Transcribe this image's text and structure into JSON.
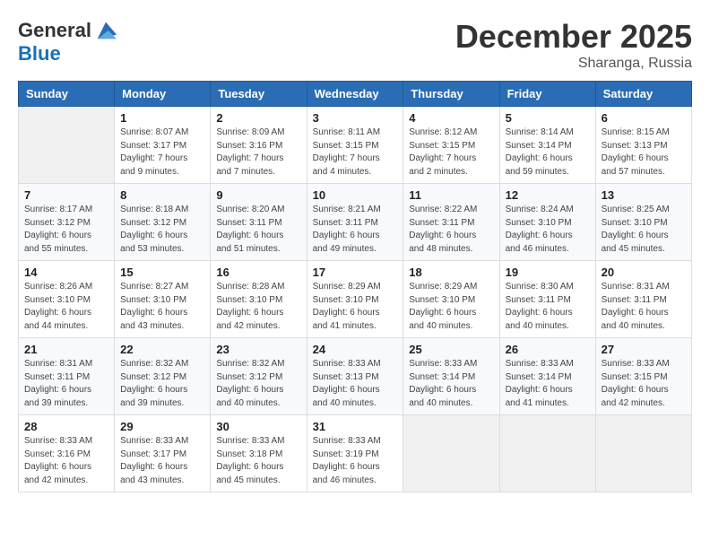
{
  "logo": {
    "line1": "General",
    "line2": "Blue"
  },
  "header": {
    "month": "December 2025",
    "location": "Sharanga, Russia"
  },
  "weekdays": [
    "Sunday",
    "Monday",
    "Tuesday",
    "Wednesday",
    "Thursday",
    "Friday",
    "Saturday"
  ],
  "weeks": [
    [
      {
        "day": "",
        "info": ""
      },
      {
        "day": "1",
        "info": "Sunrise: 8:07 AM\nSunset: 3:17 PM\nDaylight: 7 hours\nand 9 minutes."
      },
      {
        "day": "2",
        "info": "Sunrise: 8:09 AM\nSunset: 3:16 PM\nDaylight: 7 hours\nand 7 minutes."
      },
      {
        "day": "3",
        "info": "Sunrise: 8:11 AM\nSunset: 3:15 PM\nDaylight: 7 hours\nand 4 minutes."
      },
      {
        "day": "4",
        "info": "Sunrise: 8:12 AM\nSunset: 3:15 PM\nDaylight: 7 hours\nand 2 minutes."
      },
      {
        "day": "5",
        "info": "Sunrise: 8:14 AM\nSunset: 3:14 PM\nDaylight: 6 hours\nand 59 minutes."
      },
      {
        "day": "6",
        "info": "Sunrise: 8:15 AM\nSunset: 3:13 PM\nDaylight: 6 hours\nand 57 minutes."
      }
    ],
    [
      {
        "day": "7",
        "info": "Sunrise: 8:17 AM\nSunset: 3:12 PM\nDaylight: 6 hours\nand 55 minutes."
      },
      {
        "day": "8",
        "info": "Sunrise: 8:18 AM\nSunset: 3:12 PM\nDaylight: 6 hours\nand 53 minutes."
      },
      {
        "day": "9",
        "info": "Sunrise: 8:20 AM\nSunset: 3:11 PM\nDaylight: 6 hours\nand 51 minutes."
      },
      {
        "day": "10",
        "info": "Sunrise: 8:21 AM\nSunset: 3:11 PM\nDaylight: 6 hours\nand 49 minutes."
      },
      {
        "day": "11",
        "info": "Sunrise: 8:22 AM\nSunset: 3:11 PM\nDaylight: 6 hours\nand 48 minutes."
      },
      {
        "day": "12",
        "info": "Sunrise: 8:24 AM\nSunset: 3:10 PM\nDaylight: 6 hours\nand 46 minutes."
      },
      {
        "day": "13",
        "info": "Sunrise: 8:25 AM\nSunset: 3:10 PM\nDaylight: 6 hours\nand 45 minutes."
      }
    ],
    [
      {
        "day": "14",
        "info": "Sunrise: 8:26 AM\nSunset: 3:10 PM\nDaylight: 6 hours\nand 44 minutes."
      },
      {
        "day": "15",
        "info": "Sunrise: 8:27 AM\nSunset: 3:10 PM\nDaylight: 6 hours\nand 43 minutes."
      },
      {
        "day": "16",
        "info": "Sunrise: 8:28 AM\nSunset: 3:10 PM\nDaylight: 6 hours\nand 42 minutes."
      },
      {
        "day": "17",
        "info": "Sunrise: 8:29 AM\nSunset: 3:10 PM\nDaylight: 6 hours\nand 41 minutes."
      },
      {
        "day": "18",
        "info": "Sunrise: 8:29 AM\nSunset: 3:10 PM\nDaylight: 6 hours\nand 40 minutes."
      },
      {
        "day": "19",
        "info": "Sunrise: 8:30 AM\nSunset: 3:11 PM\nDaylight: 6 hours\nand 40 minutes."
      },
      {
        "day": "20",
        "info": "Sunrise: 8:31 AM\nSunset: 3:11 PM\nDaylight: 6 hours\nand 40 minutes."
      }
    ],
    [
      {
        "day": "21",
        "info": "Sunrise: 8:31 AM\nSunset: 3:11 PM\nDaylight: 6 hours\nand 39 minutes."
      },
      {
        "day": "22",
        "info": "Sunrise: 8:32 AM\nSunset: 3:12 PM\nDaylight: 6 hours\nand 39 minutes."
      },
      {
        "day": "23",
        "info": "Sunrise: 8:32 AM\nSunset: 3:12 PM\nDaylight: 6 hours\nand 40 minutes."
      },
      {
        "day": "24",
        "info": "Sunrise: 8:33 AM\nSunset: 3:13 PM\nDaylight: 6 hours\nand 40 minutes."
      },
      {
        "day": "25",
        "info": "Sunrise: 8:33 AM\nSunset: 3:14 PM\nDaylight: 6 hours\nand 40 minutes."
      },
      {
        "day": "26",
        "info": "Sunrise: 8:33 AM\nSunset: 3:14 PM\nDaylight: 6 hours\nand 41 minutes."
      },
      {
        "day": "27",
        "info": "Sunrise: 8:33 AM\nSunset: 3:15 PM\nDaylight: 6 hours\nand 42 minutes."
      }
    ],
    [
      {
        "day": "28",
        "info": "Sunrise: 8:33 AM\nSunset: 3:16 PM\nDaylight: 6 hours\nand 42 minutes."
      },
      {
        "day": "29",
        "info": "Sunrise: 8:33 AM\nSunset: 3:17 PM\nDaylight: 6 hours\nand 43 minutes."
      },
      {
        "day": "30",
        "info": "Sunrise: 8:33 AM\nSunset: 3:18 PM\nDaylight: 6 hours\nand 45 minutes."
      },
      {
        "day": "31",
        "info": "Sunrise: 8:33 AM\nSunset: 3:19 PM\nDaylight: 6 hours\nand 46 minutes."
      },
      {
        "day": "",
        "info": ""
      },
      {
        "day": "",
        "info": ""
      },
      {
        "day": "",
        "info": ""
      }
    ]
  ]
}
